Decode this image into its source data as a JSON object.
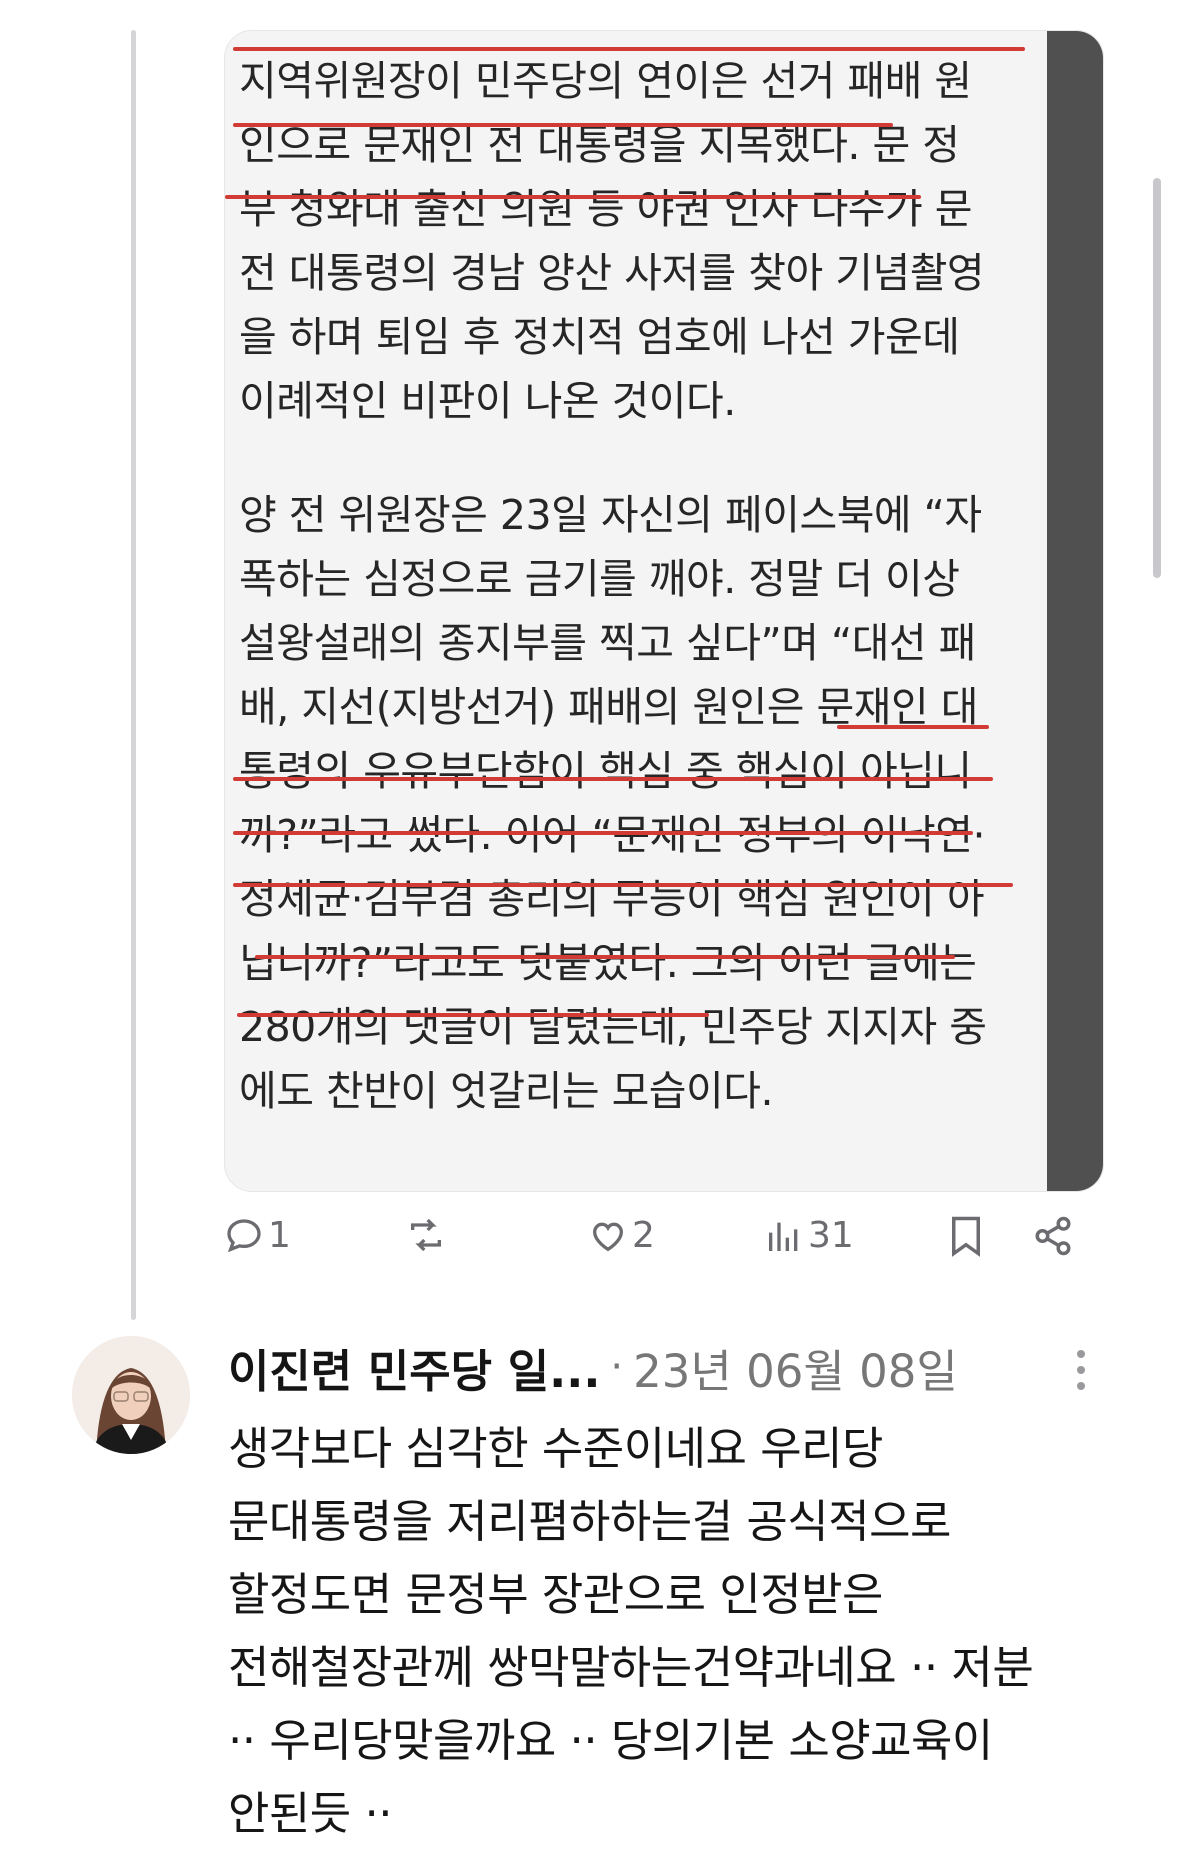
{
  "article": {
    "lines": [
      "지역위원장이 민주당의 연이은 선거 패배 원",
      "인으로 문재인 전 대통령을 지목했다. 문 정",
      "부 청와대 출신 의원 등 야권 인사 다수가 문",
      "전 대통령의 경남 양산 사저를 찾아 기념촬영",
      "을 하며 퇴임 후 정치적 엄호에 나선 가운데",
      "이례적인 비판이 나온 것이다.",
      "",
      "양 전 위원장은 23일 자신의 페이스북에 “자",
      "폭하는 심정으로 금기를 깨야. 정말 더 이상",
      "설왕설래의 종지부를 찍고 싶다”며 “대선 패",
      "배, 지선(지방선거) 패배의 원인은 문재인 대",
      "통령의 우유부단함이 핵심 중 핵심이 아닙니",
      "까?”라고 썼다. 이어 “문재인 정부의 이낙연·",
      "정세균·김부겸 총리의 무능이 핵심 원인이 아",
      "닙니까?”라고도 덧붙였다. 그의 이런 글에는",
      "280개의 댓글이 달렸는데, 민주당 지지자 중",
      "에도 찬반이 엇갈리는 모습이다."
    ]
  },
  "actions": {
    "reply_count": "1",
    "like_count": "2",
    "view_count": "31"
  },
  "reply": {
    "author": "이진련 민주당 일...",
    "separator": "·",
    "date": "23년 06월 08일",
    "lines": [
      "생각보다 심각한 수준이네요 우리당",
      "문대통령을 저리폄하하는걸 공식적으로",
      "할정도면 문정부 장관으로 인정받은",
      "전해철장관께 쌍막말하는건약과네요 ·· 저분",
      "·· 우리당맞을까요 ·· 당의기본 소양교육이",
      "안된듯 ··"
    ]
  },
  "icons": {
    "reply": "speech-bubble-icon",
    "repost": "repost-arrows-icon",
    "like": "heart-icon",
    "views": "bar-chart-icon",
    "bookmark": "bookmark-icon",
    "share": "share-icon",
    "more": "vertical-ellipsis-icon"
  },
  "colors": {
    "underline": "#d23a35",
    "icon_gray": "#6c6c70",
    "card_background": "#f4f4f5",
    "card_scrollbar": "#505050"
  }
}
